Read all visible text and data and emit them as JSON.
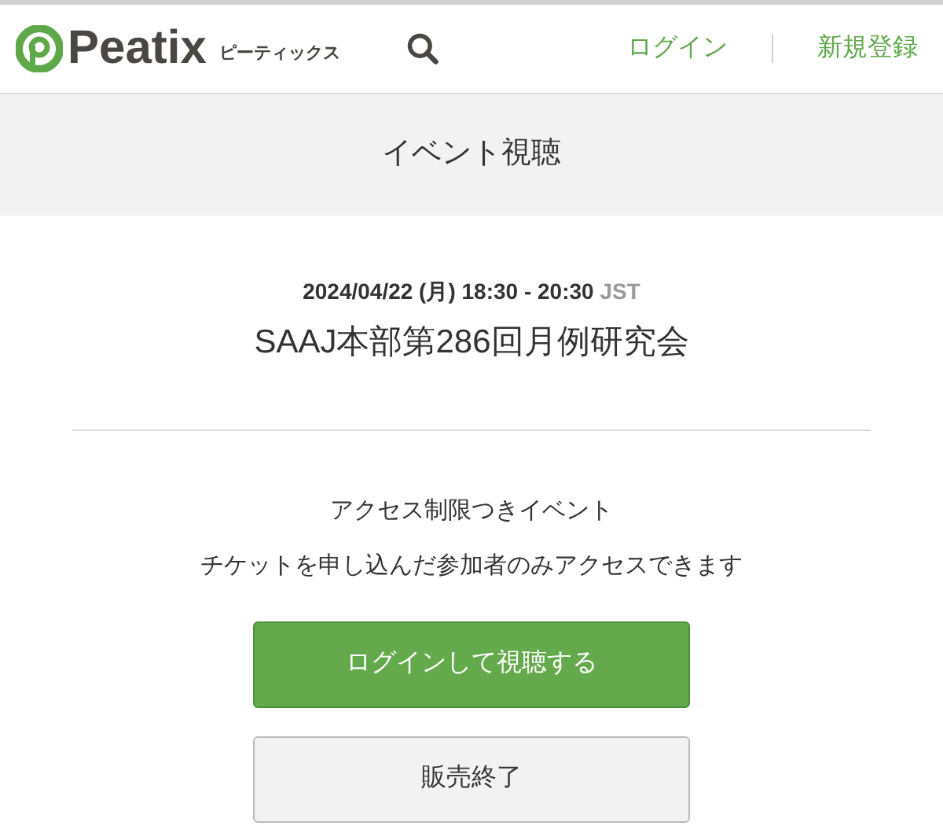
{
  "header": {
    "logo": "Peatix",
    "logo_kana": "ピーティックス",
    "links": [
      {
        "label": "ログイン"
      },
      {
        "label": "新規登録"
      }
    ]
  },
  "page_title": "イベント視聴",
  "event": {
    "datetime": "2024/04/22 (月) 18:30 - 20:30",
    "timezone": "JST",
    "title": "SAAJ本部第286回月例研究会"
  },
  "notice": {
    "heading": "アクセス制限つきイベント",
    "text": "チケットを申し込んだ参加者のみアクセスできます"
  },
  "buttons": [
    {
      "label": "ログインして視聴する",
      "kind": "primary"
    },
    {
      "label": "販売終了",
      "kind": "disabled"
    }
  ]
}
